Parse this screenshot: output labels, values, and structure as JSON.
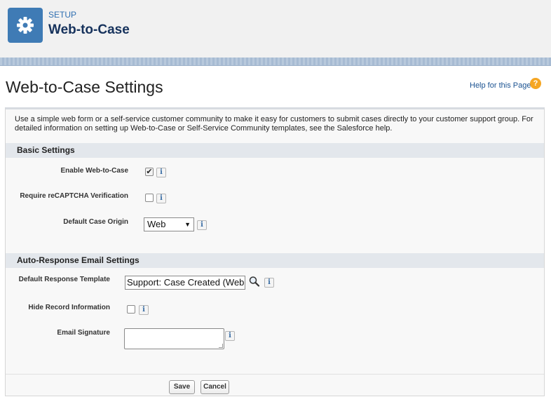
{
  "header": {
    "icon": "gear-icon",
    "label": "SETUP",
    "title": "Web-to-Case"
  },
  "page": {
    "title": "Web-to-Case Settings",
    "help_link": "Help for this Page",
    "help_icon": "question-icon",
    "intro": "Use a simple web form or a self-service customer community to make it easy for customers to submit cases directly to your customer support group. For detailed information on setting up Web-to-Case or Self-Service Community templates, see the Salesforce help."
  },
  "basic_settings": {
    "title": "Basic Settings",
    "enable_label": "Enable Web-to-Case",
    "enable_checked": true,
    "recaptcha_label": "Require reCAPTCHA Verification",
    "recaptcha_checked": false,
    "origin_label": "Default Case Origin",
    "origin_value": "Web"
  },
  "auto_response": {
    "title": "Auto-Response Email Settings",
    "template_label": "Default Response Template",
    "template_value": "Support: Case Created (Web",
    "hide_label": "Hide Record Information",
    "hide_checked": false,
    "signature_label": "Email Signature",
    "signature_value": ""
  },
  "buttons": {
    "save": "Save",
    "cancel": "Cancel"
  },
  "colors": {
    "accent": "#3f7bb5",
    "title": "#16325c",
    "help": "#f5a623"
  }
}
